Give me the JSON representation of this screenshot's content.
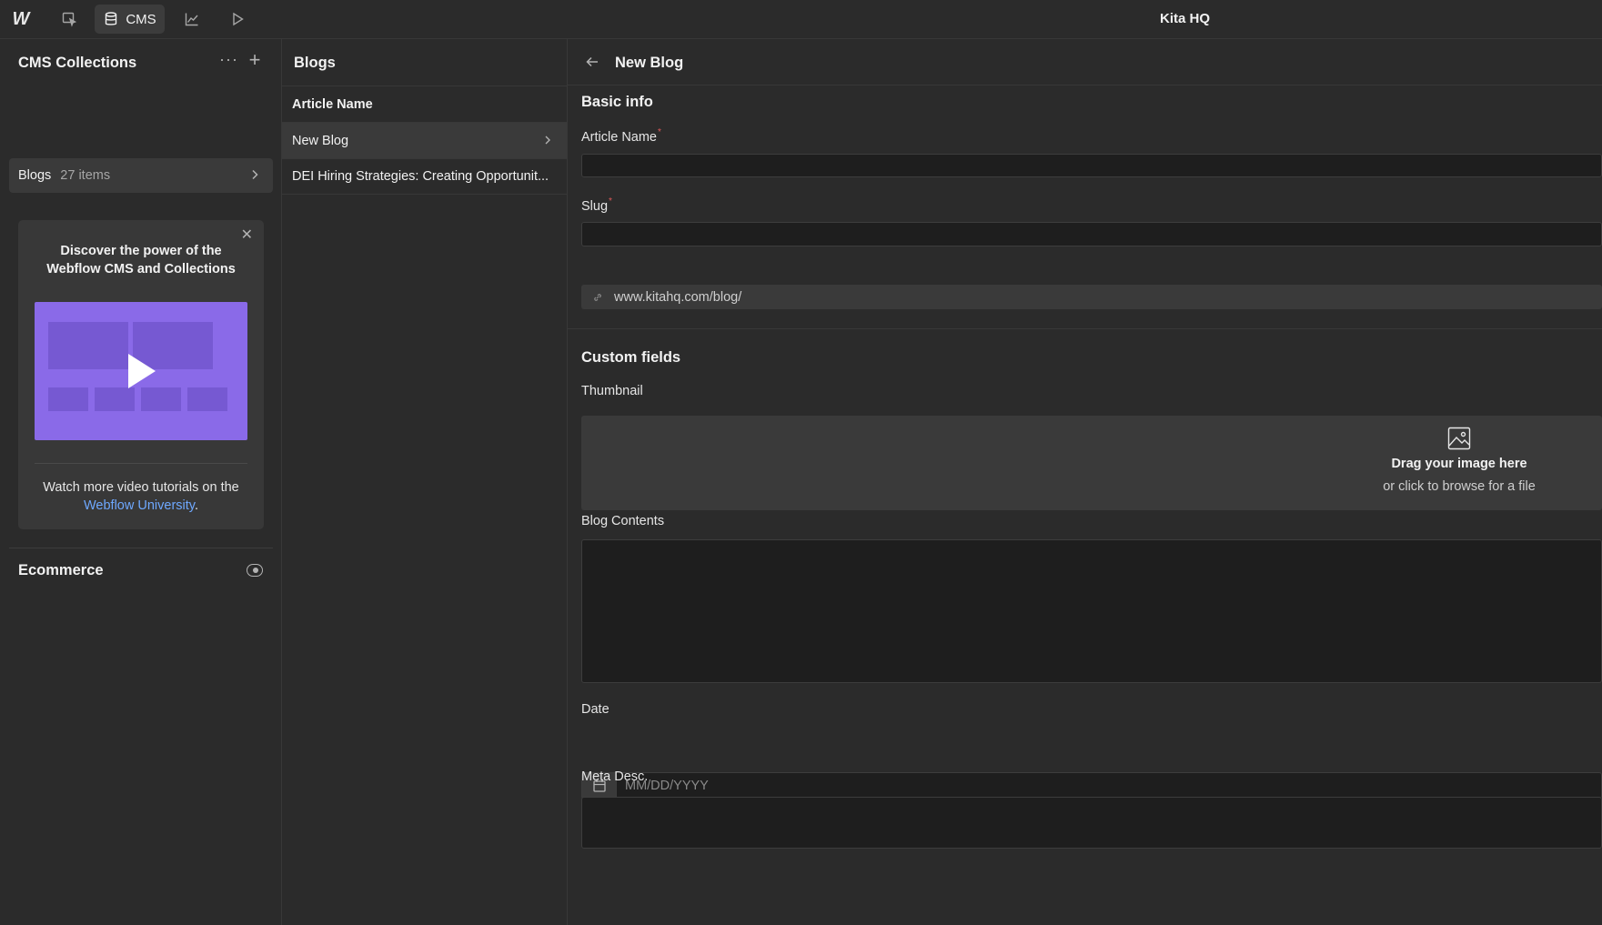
{
  "topbar": {
    "logo": "W",
    "cms_label": "CMS",
    "site_title": "Kita HQ"
  },
  "left_panel": {
    "title": "CMS Collections",
    "more_glyph": "···",
    "add_glyph": "+",
    "collection": {
      "name": "Blogs",
      "count": "27 items"
    },
    "promo": {
      "title": "Discover the power of the Webflow CMS and Collections",
      "footer_text": "Watch more video tutorials on the",
      "footer_link": "Webflow University",
      "footer_end": ".",
      "video_color": "#8a6ae8"
    },
    "ecommerce_title": "Ecommerce"
  },
  "middle_panel": {
    "title": "Blogs",
    "column_header": "Article Name",
    "items": [
      {
        "label": "New Blog"
      },
      {
        "label": "DEI Hiring Strategies: Creating Opportunit..."
      }
    ]
  },
  "editor": {
    "title": "New Blog",
    "basic_info_title": "Basic info",
    "article_name_label": "Article Name",
    "slug_label": "Slug",
    "slug_prefix": "www.kitahq.com/blog/",
    "custom_fields_title": "Custom fields",
    "thumbnail_label": "Thumbnail",
    "dropzone_main": "Drag your image here",
    "dropzone_sub": "or click to browse for a file",
    "blog_contents_label": "Blog Contents",
    "date_label": "Date",
    "date_placeholder": "MM/DD/YYYY",
    "meta_desc_label": "Meta Desc.",
    "required_mark": "*"
  },
  "colors": {
    "background": "#1e1e1e",
    "panel": "#2b2b2b",
    "accent_link": "#6ea8ff",
    "required": "#e05a5a"
  }
}
